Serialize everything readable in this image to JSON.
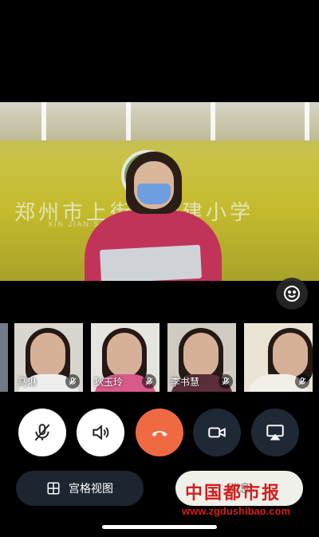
{
  "main_video": {
    "wall_text": "郑州市上街区新建小学",
    "wall_subtext": "XIN JIAN  SCHOOL"
  },
  "participants": [
    {
      "name": ""
    },
    {
      "name": "马琳"
    },
    {
      "name": "狄玉玲"
    },
    {
      "name": "李书慧"
    },
    {
      "name": ""
    }
  ],
  "controls": {
    "grid_view_label": "宫格视图",
    "message_label": "消息"
  },
  "watermark": {
    "title": "中国都市报",
    "url": "www.zgdushibao.com"
  },
  "icons": [
    "emoji-icon",
    "mic-muted-icon",
    "speaker-icon",
    "hangup-icon",
    "camera-icon",
    "screen-share-icon",
    "grid-icon"
  ],
  "colors": {
    "hangup": "#ef6a42",
    "dark_button": "#1f2936",
    "watermark": "#d21f1f"
  }
}
